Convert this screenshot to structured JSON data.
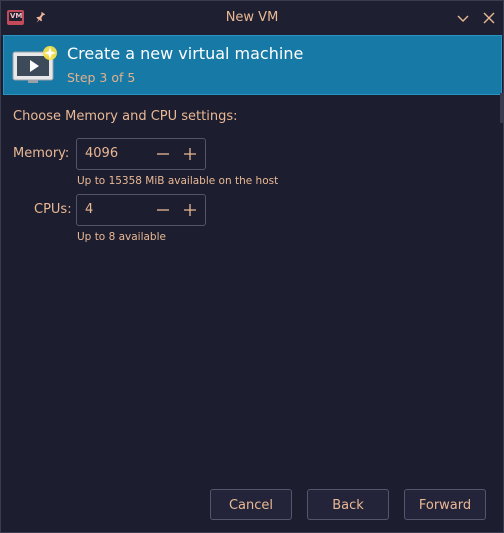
{
  "window": {
    "title": "New VM"
  },
  "banner": {
    "title": "Create a new virtual machine",
    "step": "Step 3 of 5"
  },
  "content": {
    "section_label": "Choose Memory and CPU settings:",
    "memory": {
      "label": "Memory:",
      "value": "4096",
      "hint": "Up to 15358 MiB available on the host"
    },
    "cpus": {
      "label": "CPUs:",
      "value": "4",
      "hint": "Up to 8 available"
    }
  },
  "buttons": {
    "cancel": "Cancel",
    "back": "Back",
    "forward": "Forward"
  },
  "icons": {
    "app": "virt-manager-icon",
    "pin": "pin-icon",
    "minimize": "chevron-down-icon",
    "close": "close-icon",
    "banner": "new-vm-monitor-icon"
  },
  "colors": {
    "accent": "#1679a6",
    "text": "#e9b894",
    "background": "#1c1d2f"
  }
}
